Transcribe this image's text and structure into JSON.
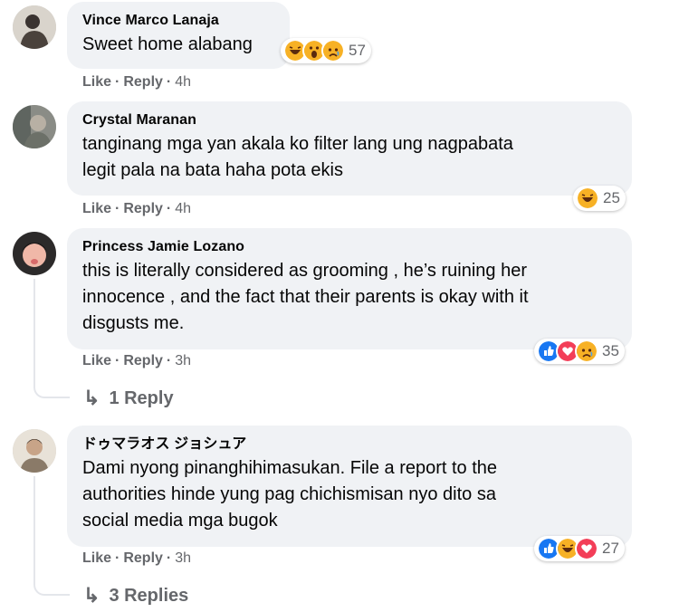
{
  "comments": [
    {
      "author": "Vince Marco Lanaja",
      "text": "Sweet home alabang",
      "reaction_count": "57",
      "reactions": [
        "haha",
        "wow",
        "sad"
      ],
      "like": "Like",
      "reply": "Reply",
      "time": "4h"
    },
    {
      "author": "Crystal Maranan",
      "text": "tanginang mga yan akala ko filter lang ung nagpabata\nlegit pala na bata haha pota ekis",
      "reaction_count": "25",
      "reactions": [
        "haha"
      ],
      "like": "Like",
      "reply": "Reply",
      "time": "4h"
    },
    {
      "author": "Princess Jamie Lozano",
      "text": "this is literally considered as grooming , he’s ruining her\ninnocence , and the fact that their parents is okay with it\ndisgusts me.",
      "reaction_count": "35",
      "reactions": [
        "like",
        "love",
        "sad"
      ],
      "like": "Like",
      "reply": "Reply",
      "time": "3h",
      "replies_label": "1 Reply"
    },
    {
      "author": "ドゥマラオス ジョシュア",
      "text": "Dami nyong pinanghihimasukan. File a report to the\nauthorities hinde yung pag chichismisan nyo dito sa\nsocial media mga bugok",
      "reaction_count": "27",
      "reactions": [
        "like",
        "haha",
        "love"
      ],
      "like": "Like",
      "reply": "Reply",
      "time": "3h",
      "replies_label": "3 Replies"
    }
  ],
  "reaction_colors": {
    "like": "#1877f2",
    "love": "#f33e58",
    "haha": "#f7b125",
    "wow": "#f7b125",
    "sad": "#f7b125"
  }
}
